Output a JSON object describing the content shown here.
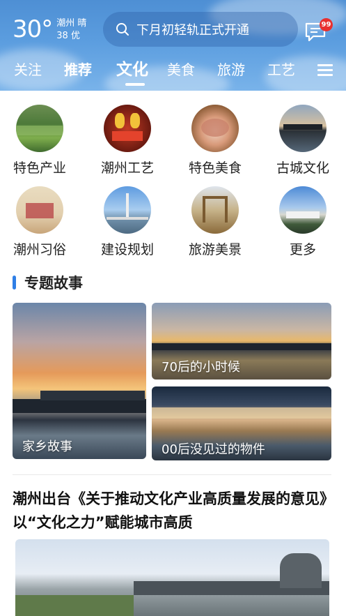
{
  "header": {
    "temperature": "30°",
    "city_weather": "潮州 晴",
    "aqi": "38 优",
    "search_placeholder": "下月初轻轨正式开通",
    "message_badge": "99",
    "tabs": [
      {
        "label": "关注"
      },
      {
        "label": "推荐"
      },
      {
        "label": "文化"
      },
      {
        "label": "美食"
      },
      {
        "label": "旅游"
      },
      {
        "label": "工艺"
      }
    ],
    "active_tab": "文化"
  },
  "categories": [
    {
      "label": "特色产业",
      "icon": "tea-field-icon"
    },
    {
      "label": "潮州工艺",
      "icon": "lantern-craft-icon"
    },
    {
      "label": "特色美食",
      "icon": "food-icon"
    },
    {
      "label": "古城文化",
      "icon": "bridge-icon"
    },
    {
      "label": "潮州习俗",
      "icon": "custom-icon"
    },
    {
      "label": "建设规划",
      "icon": "cable-bridge-icon"
    },
    {
      "label": "旅游美景",
      "icon": "archway-icon"
    },
    {
      "label": "更多",
      "icon": "more-icon"
    }
  ],
  "section": {
    "title": "专题故事"
  },
  "stories": [
    {
      "caption": "家乡故事"
    },
    {
      "caption": "70后的小时候"
    },
    {
      "caption": "00后没见过的物件"
    }
  ],
  "news": {
    "headline": "潮州出台《关于推动文化产业高质量发展的意见》以“文化之力”赋能城市高质"
  },
  "colors": {
    "header_blue": "#5b9ddf",
    "accent_blue": "#2f7fe6",
    "badge_red": "#e8302f"
  }
}
